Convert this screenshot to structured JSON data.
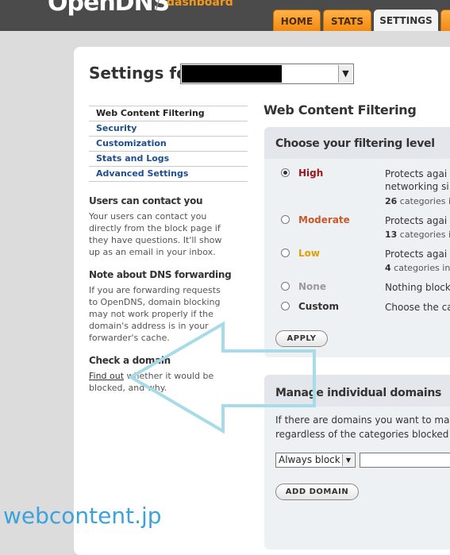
{
  "brand": {
    "name": "OpenDNS",
    "slash": "/",
    "sub": "dashboard",
    "color": "#f39a1a"
  },
  "tabs": [
    {
      "label": "HOME"
    },
    {
      "label": "STATS"
    },
    {
      "label": "SETTINGS",
      "active": true
    },
    {
      "label": ""
    }
  ],
  "settings": {
    "label": "Settings for:",
    "network_value": ""
  },
  "nav": [
    {
      "label": "Web Content Filtering",
      "current": true
    },
    {
      "label": "Security"
    },
    {
      "label": "Customization"
    },
    {
      "label": "Stats and Logs"
    },
    {
      "label": "Advanced Settings"
    }
  ],
  "sidebar": {
    "contact_title": "Users can contact you",
    "contact_text": "Your users can contact you directly from the block page if they have questions. It'll show up as an email in your inbox.",
    "dns_title": "Note about DNS forwarding",
    "dns_text": "If you are forwarding requests to OpenDNS, domain blocking may not work properly if the domain's address is in your forwarder's cache.",
    "check_title": "Check a domain",
    "check_link": "Find out",
    "check_text": " whether it would be blocked, and why."
  },
  "filtering": {
    "title": "Web Content Filtering",
    "box_title": "Choose your filtering level",
    "levels": [
      {
        "name": "High",
        "color": "#a0161a",
        "desc": "Protects agai",
        "desc2": "networking si",
        "count": "26",
        "count_suffix": " categories i",
        "checked": true
      },
      {
        "name": "Moderate",
        "color": "#c9582a",
        "desc": "Protects agai",
        "count": "13",
        "count_suffix": " categories i"
      },
      {
        "name": "Low",
        "color": "#e0a100",
        "desc": "Protects agai",
        "count": "4",
        "count_suffix": " categories in"
      },
      {
        "name": "None",
        "color": "#9a9a9a",
        "desc": "Nothing block"
      },
      {
        "name": "Custom",
        "color": "#333333",
        "desc": "Choose the ca"
      }
    ],
    "apply_label": "APPLY"
  },
  "domains": {
    "title": "Manage individual domains",
    "desc_line1": "If there are domains you want to ma",
    "desc_line2": "regardless of the categories blocked",
    "select_value": "Always block",
    "input_value": "",
    "add_label": "ADD DOMAIN"
  },
  "watermark": "webcontent.jp",
  "overlay_color": "#a8dbe8"
}
